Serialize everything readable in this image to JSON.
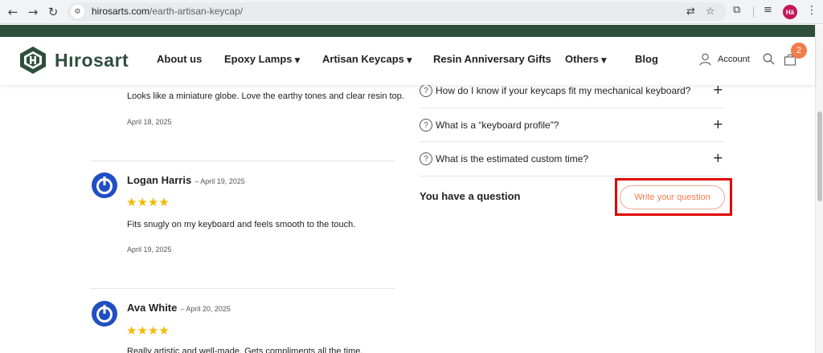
{
  "browser": {
    "url_domain": "hirosarts.com",
    "url_path": "/earth-artisan-keycap/",
    "profile_initials": "Hà"
  },
  "colors": {
    "brand_green": "#2f4e3c",
    "accent_orange": "#f37b4c",
    "star_gold": "#f5b800",
    "highlight_red": "#e00000",
    "avatar_blue": "#1f4fc2"
  },
  "header": {
    "logo_text": "Hırosart",
    "nav": [
      {
        "label": "About us",
        "has_dropdown": false
      },
      {
        "label": "Epoxy Lamps",
        "has_dropdown": true
      },
      {
        "label": "Artisan Keycaps",
        "has_dropdown": true
      },
      {
        "label": "Resin Anniversary Gifts",
        "has_dropdown": false
      },
      {
        "label": "Others",
        "has_dropdown": true
      },
      {
        "label": "Blog",
        "has_dropdown": false
      }
    ],
    "account_label": "Account",
    "cart_count": "2"
  },
  "reviews": {
    "partial": {
      "text": "Looks like a miniature globe. Love the earthy tones and clear resin top.",
      "date": "April 18, 2025"
    },
    "items": [
      {
        "name": "Logan Harris",
        "meta": "– April 19, 2025",
        "stars": "★★★★",
        "text": "Fits snugly on my keyboard and feels smooth to the touch.",
        "date": "April 19, 2025"
      },
      {
        "name": "Ava White",
        "meta": "– April 20, 2025",
        "stars": "★★★★",
        "text": "Really artistic and well-made. Gets compliments all the time.",
        "date": ""
      }
    ]
  },
  "faq": {
    "items": [
      {
        "question": "How do I know if your keycaps fit my mechanical keyboard?"
      },
      {
        "question": "What is a “keyboard profile”?"
      },
      {
        "question": "What is the estimated custom time?"
      }
    ],
    "question_label": "You have a question",
    "write_button": "Write your question"
  }
}
